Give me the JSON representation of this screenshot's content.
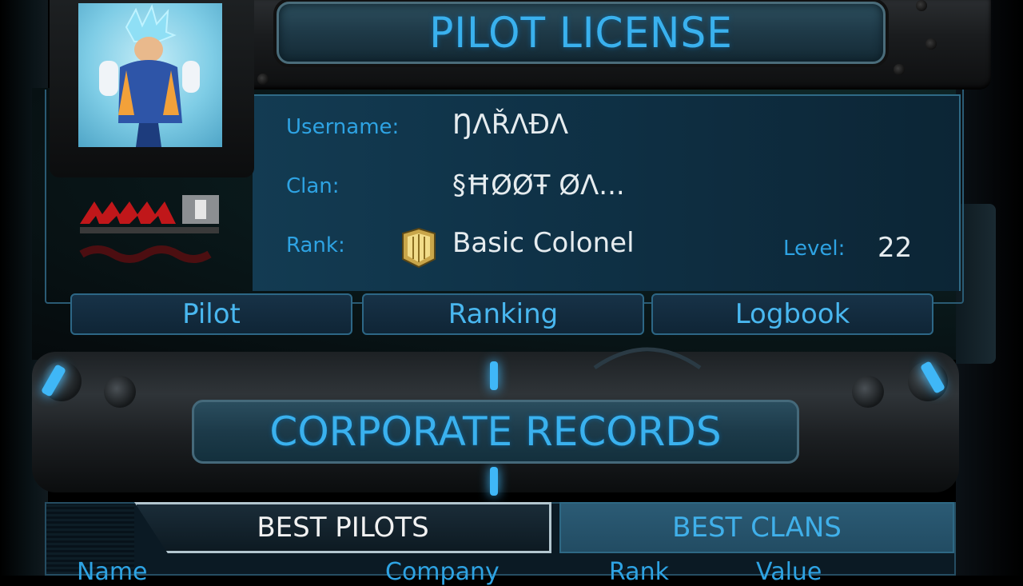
{
  "header": {
    "title": "PILOT LICENSE"
  },
  "pilot": {
    "username_label": "Username:",
    "username": "ŊΛŘΛÐΛ",
    "clan_label": "Clan:",
    "clan": "§ĦØØŦ ØΛ...",
    "rank_label": "Rank:",
    "rank": "Basic Colonel",
    "level_label": "Level:",
    "level": "22"
  },
  "tabs": [
    {
      "label": "Pilot"
    },
    {
      "label": "Ranking"
    },
    {
      "label": "Logbook"
    }
  ],
  "records": {
    "title": "CORPORATE RECORDS",
    "tabs": [
      {
        "label": "BEST PILOTS",
        "active": true
      },
      {
        "label": "BEST CLANS",
        "active": false
      }
    ],
    "columns": [
      "Name",
      "Company",
      "Rank",
      "Value"
    ]
  },
  "colors": {
    "accent": "#2ea3e3",
    "text": "#e6ecef"
  }
}
